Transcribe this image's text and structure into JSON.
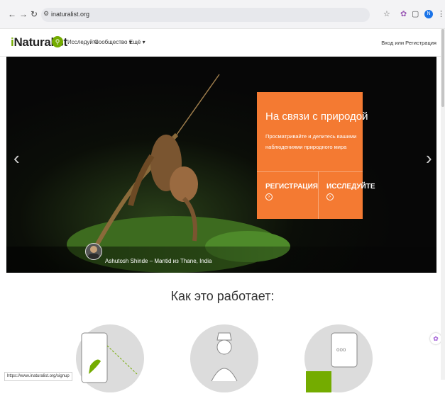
{
  "browser": {
    "url": "inaturalist.org",
    "back_icon": "arrow-left-icon",
    "forward_icon": "arrow-right-icon",
    "reload_icon": "reload-icon",
    "profile_initial": "N"
  },
  "header": {
    "logo_i": "i",
    "logo_rest": "Naturalist",
    "nav": [
      "Исследуйте",
      "Сообщество",
      "Ещё"
    ],
    "login": "Вход или Регистрация"
  },
  "hero": {
    "title": "На связи с природой",
    "description": "Просматривайте и делитесь вашими наблюдениями природного мира",
    "signup": "РЕГИСТРАЦИЯ",
    "explore": "ИССЛЕДУЙТЕ",
    "caption": "Ashutosh Shinde – Mantid из Thane, India"
  },
  "how_it_works": {
    "title": "Как это работает:"
  },
  "status_bar": {
    "url": "https://www.inaturalist.org/signup"
  },
  "colors": {
    "brand": "#74ac00",
    "cta": "#f47a32"
  }
}
